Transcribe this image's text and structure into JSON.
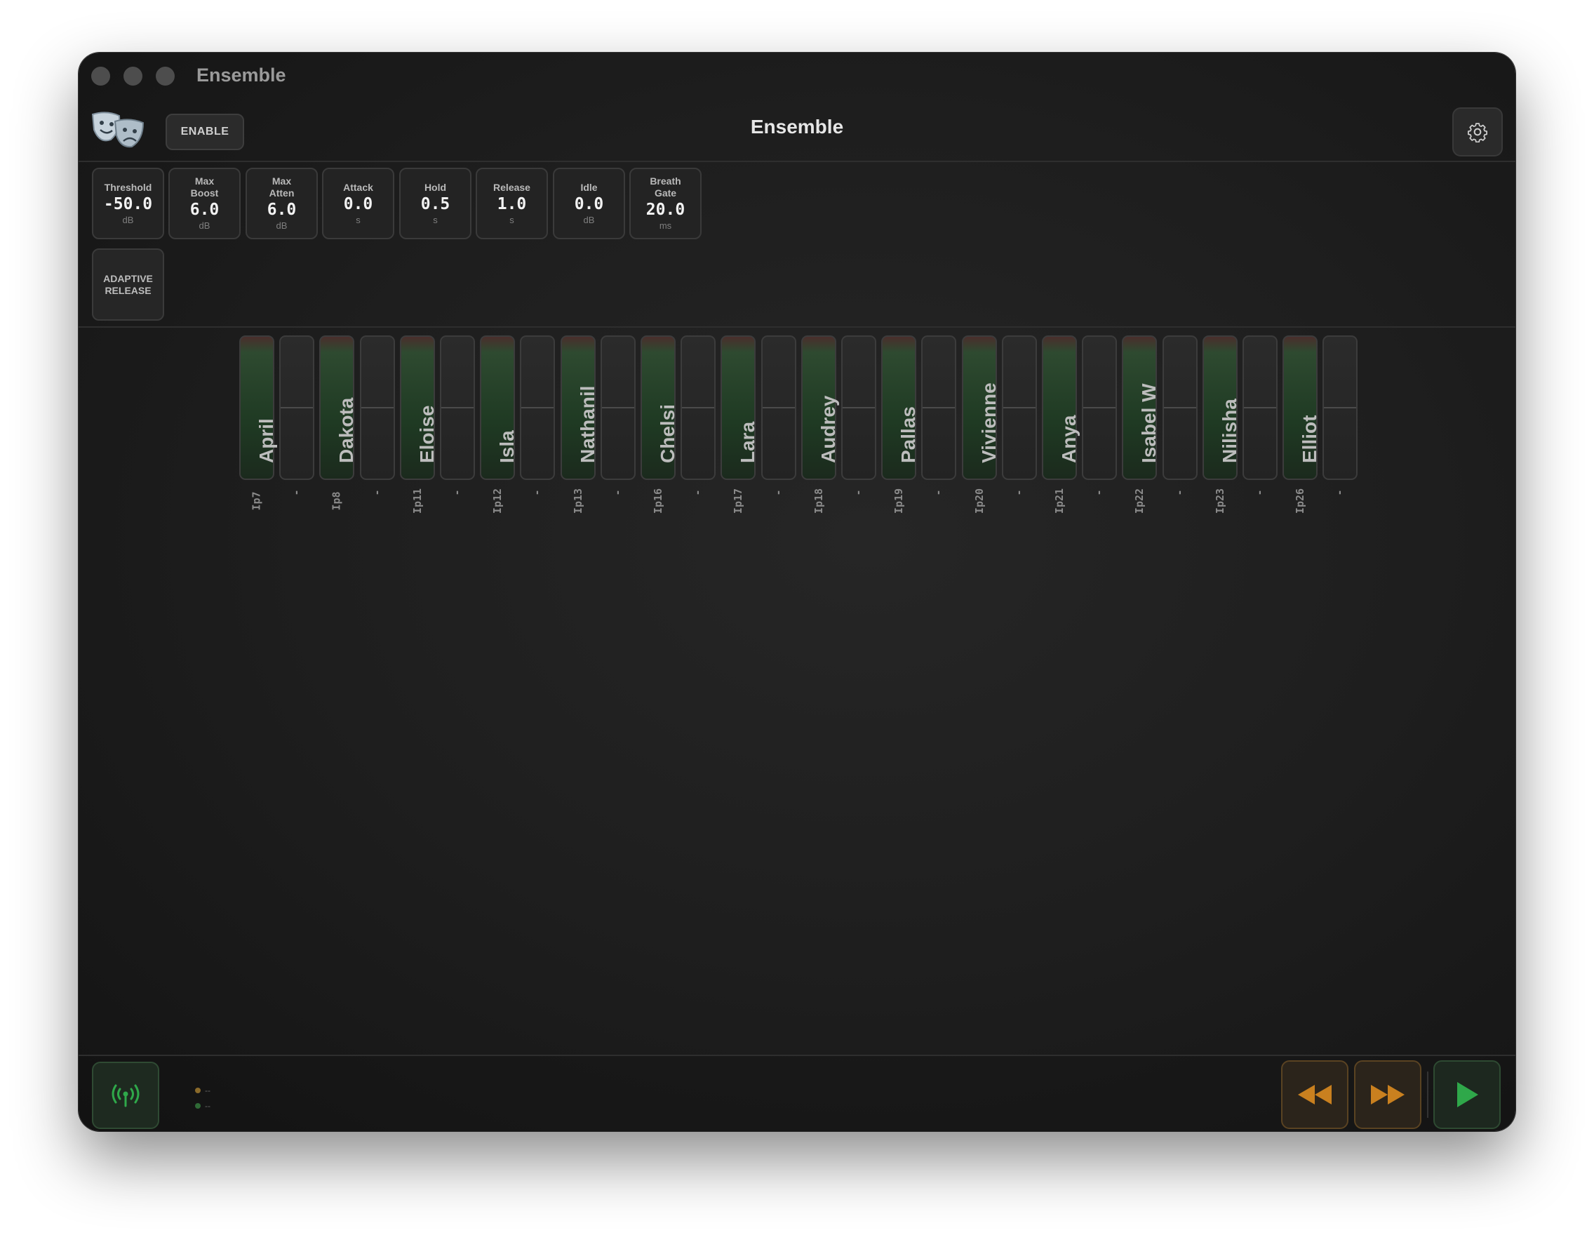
{
  "window": {
    "title": "Ensemble"
  },
  "header": {
    "title": "Ensemble",
    "enable_label": "ENABLE"
  },
  "params": [
    {
      "label": "Threshold",
      "value": "-50.0",
      "unit": "dB"
    },
    {
      "label": "Max Boost",
      "value": "6.0",
      "unit": "dB"
    },
    {
      "label": "Max Atten",
      "value": "6.0",
      "unit": "dB"
    },
    {
      "label": "Attack",
      "value": "0.0",
      "unit": "s"
    },
    {
      "label": "Hold",
      "value": "0.5",
      "unit": "s"
    },
    {
      "label": "Release",
      "value": "1.0",
      "unit": "s"
    },
    {
      "label": "Idle",
      "value": "0.0",
      "unit": "dB"
    },
    {
      "label": "Breath Gate",
      "value": "20.0",
      "unit": "ms"
    }
  ],
  "adaptive_release_label": "ADAPTIVE RELEASE",
  "channels": [
    {
      "name": "April",
      "input": "Ip7"
    },
    {
      "name": "",
      "input": "-"
    },
    {
      "name": "Dakota",
      "input": "Ip8"
    },
    {
      "name": "",
      "input": "-"
    },
    {
      "name": "Eloise",
      "input": "Ip11"
    },
    {
      "name": "",
      "input": "-"
    },
    {
      "name": "Isla",
      "input": "Ip12"
    },
    {
      "name": "",
      "input": "-"
    },
    {
      "name": "Nathanil",
      "input": "Ip13"
    },
    {
      "name": "",
      "input": "-"
    },
    {
      "name": "Chelsi",
      "input": "Ip16"
    },
    {
      "name": "",
      "input": "-"
    },
    {
      "name": "Lara",
      "input": "Ip17"
    },
    {
      "name": "",
      "input": "-"
    },
    {
      "name": "Audrey",
      "input": "Ip18"
    },
    {
      "name": "",
      "input": "-"
    },
    {
      "name": "Pallas",
      "input": "Ip19"
    },
    {
      "name": "",
      "input": "-"
    },
    {
      "name": "Vivienne",
      "input": "Ip20"
    },
    {
      "name": "",
      "input": "-"
    },
    {
      "name": "Anya",
      "input": "Ip21"
    },
    {
      "name": "",
      "input": "-"
    },
    {
      "name": "Isabel W",
      "input": "Ip22"
    },
    {
      "name": "",
      "input": "-"
    },
    {
      "name": "Nilisha",
      "input": "Ip23"
    },
    {
      "name": "",
      "input": "-"
    },
    {
      "name": "Elliot",
      "input": "Ip26"
    },
    {
      "name": "",
      "input": "-"
    }
  ],
  "footer": {
    "legend": [
      {
        "color": "#8a6a2a",
        "text": "--"
      },
      {
        "color": "#2f6a36",
        "text": "--"
      }
    ]
  },
  "colors": {
    "accent_green": "#2fa84a",
    "accent_orange": "#c9801f"
  },
  "icons": {
    "logo": "theater-masks-icon",
    "settings": "gear-icon",
    "network": "antenna-icon",
    "rewind": "rewind-icon",
    "fast_forward": "fast-forward-icon",
    "play": "play-icon"
  }
}
